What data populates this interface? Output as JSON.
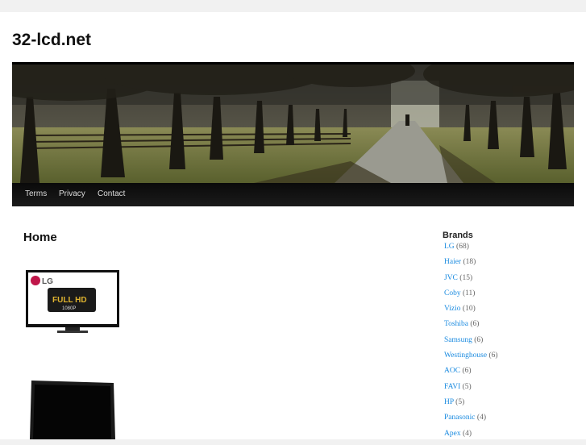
{
  "site": {
    "title": "32-lcd.net"
  },
  "nav": {
    "items": [
      {
        "label": "Terms"
      },
      {
        "label": "Privacy"
      },
      {
        "label": "Contact"
      }
    ]
  },
  "main": {
    "page_title": "Home",
    "products": [
      {
        "icon": "lg-fullhd-tv-image",
        "logo_text": "LG",
        "badge_text": "FULL HD",
        "badge_sub": "1080P"
      },
      {
        "icon": "lcd-tv-image"
      }
    ]
  },
  "sidebar": {
    "title": "Brands",
    "brands": [
      {
        "name": "LG",
        "count": "(68)"
      },
      {
        "name": "Haier",
        "count": "(18)"
      },
      {
        "name": "JVC",
        "count": "(15)"
      },
      {
        "name": "Coby",
        "count": "(11)"
      },
      {
        "name": "Vizio",
        "count": "(10)"
      },
      {
        "name": "Toshiba",
        "count": "(6)"
      },
      {
        "name": "Samsung",
        "count": "(6)"
      },
      {
        "name": "Westinghouse",
        "count": "(6)"
      },
      {
        "name": "AOC",
        "count": "(6)"
      },
      {
        "name": "FAVI",
        "count": "(5)"
      },
      {
        "name": "HP",
        "count": "(5)"
      },
      {
        "name": "Panasonic",
        "count": "(4)"
      },
      {
        "name": "Apex",
        "count": "(4)"
      }
    ]
  },
  "colors": {
    "link": "#1b8be0",
    "nav_bg": "#111111",
    "page_bg": "#f1f1f1"
  }
}
